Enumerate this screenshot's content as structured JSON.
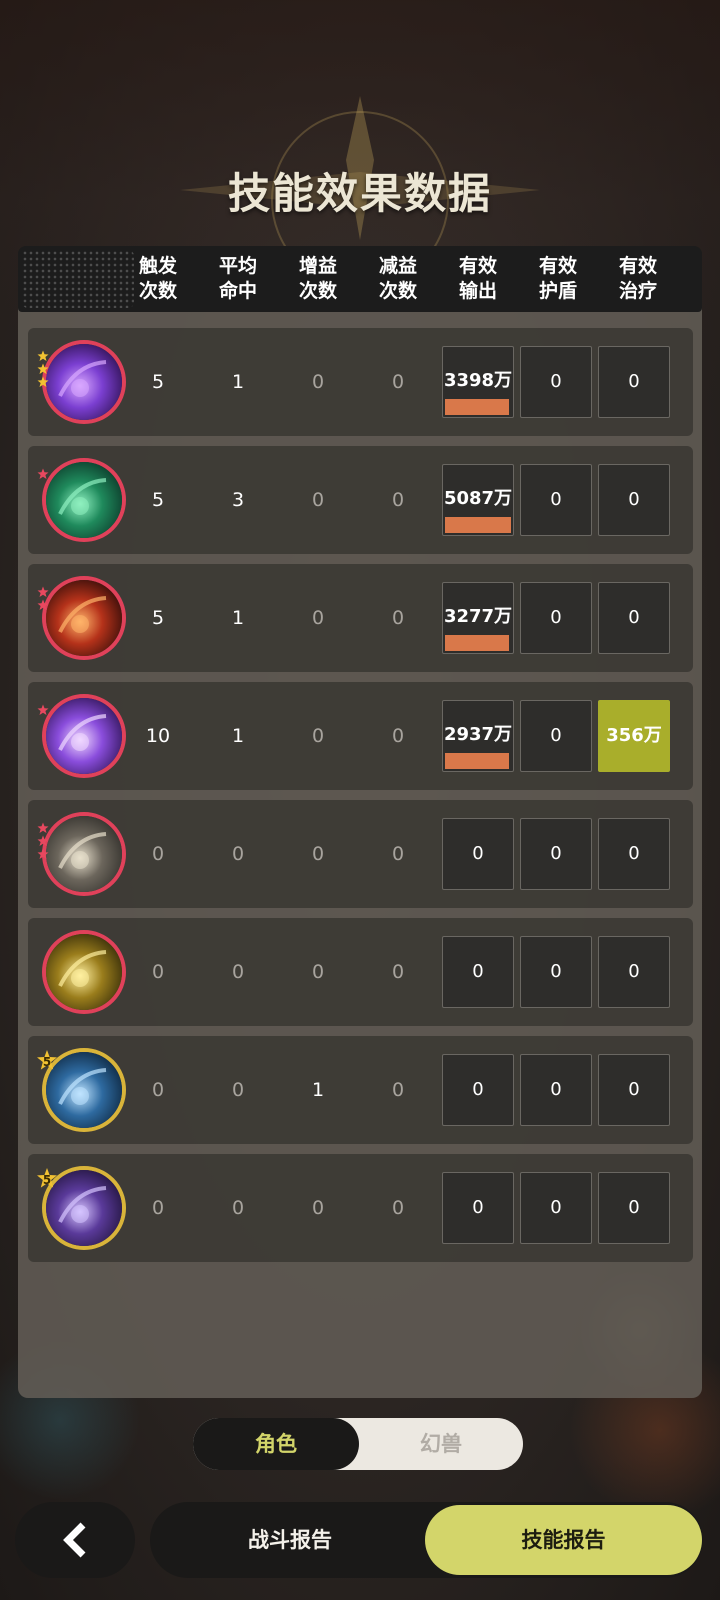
{
  "title": "技能效果数据",
  "columns": [
    {
      "line1": "触发",
      "line2": "次数"
    },
    {
      "line1": "平均",
      "line2": "命中"
    },
    {
      "line1": "增益",
      "line2": "次数"
    },
    {
      "line1": "减益",
      "line2": "次数"
    },
    {
      "line1": "有效",
      "line2": "输出"
    },
    {
      "line1": "有效",
      "line2": "护盾"
    },
    {
      "line1": "有效",
      "line2": "治疗"
    }
  ],
  "rows": [
    {
      "icon": "purple-orb-skill-icon",
      "stars": 3,
      "trigger": "5",
      "hit": "1",
      "buff": "0",
      "debuff": "0",
      "output": "3398万",
      "output_share": 0.97,
      "shield": "0",
      "heal": "0",
      "heal_share": 0
    },
    {
      "icon": "green-vortex-skill-icon",
      "stars": 1,
      "trigger": "5",
      "hit": "3",
      "buff": "0",
      "debuff": "0",
      "output": "5087万",
      "output_share": 1.0,
      "shield": "0",
      "heal": "0",
      "heal_share": 0
    },
    {
      "icon": "fire-slash-skill-icon",
      "stars": 2,
      "trigger": "5",
      "hit": "1",
      "buff": "0",
      "debuff": "0",
      "output": "3277万",
      "output_share": 0.97,
      "shield": "0",
      "heal": "0",
      "heal_share": 0
    },
    {
      "icon": "violet-burst-skill-icon",
      "stars": 1,
      "trigger": "10",
      "hit": "1",
      "buff": "0",
      "debuff": "0",
      "output": "2937万",
      "output_share": 0.97,
      "shield": "0",
      "heal": "356万",
      "heal_share": 1.0
    },
    {
      "icon": "shield-warrior-skill-icon",
      "stars": 3,
      "trigger": "0",
      "hit": "0",
      "buff": "0",
      "debuff": "0",
      "output": "0",
      "output_share": 0,
      "shield": "0",
      "heal": "0",
      "heal_share": 0
    },
    {
      "icon": "golden-eye-skill-icon",
      "stars": 0,
      "trigger": "0",
      "hit": "0",
      "buff": "0",
      "debuff": "0",
      "output": "0",
      "output_share": 0,
      "shield": "0",
      "heal": "0",
      "heal_share": 0
    },
    {
      "icon": "blue-crystal-skill-icon",
      "level": "5",
      "trigger": "0",
      "hit": "0",
      "buff": "1",
      "debuff": "0",
      "output": "0",
      "output_share": 0,
      "shield": "0",
      "heal": "0",
      "heal_share": 0
    },
    {
      "icon": "purple-beast-skill-icon",
      "level": "5",
      "trigger": "0",
      "hit": "0",
      "buff": "0",
      "debuff": "0",
      "output": "0",
      "output_share": 0,
      "shield": "0",
      "heal": "0",
      "heal_share": 0
    }
  ],
  "toggle": {
    "active": "角色",
    "inactive": "幻兽"
  },
  "nav": {
    "back_icon": "chevron-left-icon",
    "battle_report": "战斗报告",
    "skill_report": "技能报告"
  },
  "colors": {
    "accent": "#d3d56a",
    "output_bar": "#d9784a",
    "heal_fill": "#a9ae2b",
    "gold_ring": "#d9b43a",
    "red_ring": "#e0415a"
  }
}
